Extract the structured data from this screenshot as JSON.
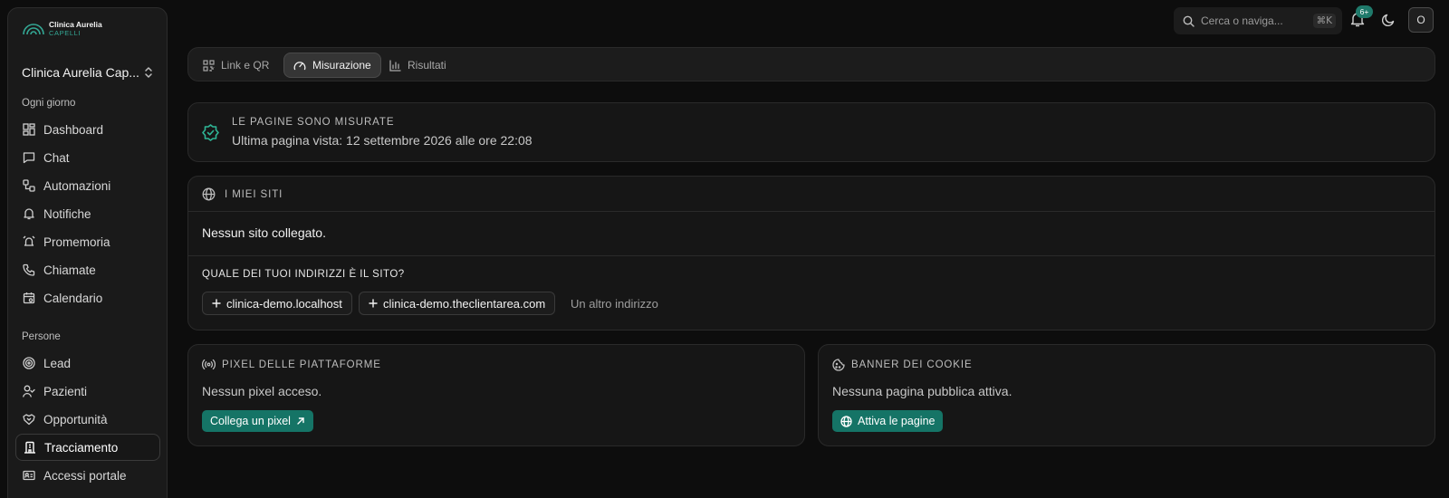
{
  "brand": {
    "name": "Clinica Aurelia",
    "sub": "CAPELLI",
    "accent": "#34a895"
  },
  "org": {
    "name": "Clinica Aurelia Cap..."
  },
  "sidebar": {
    "section_daily": "Ogni giorno",
    "daily_items": [
      {
        "label": "Dashboard",
        "icon": "dashboard-icon"
      },
      {
        "label": "Chat",
        "icon": "chat-icon"
      },
      {
        "label": "Automazioni",
        "icon": "automation-icon"
      },
      {
        "label": "Notifiche",
        "icon": "bell-icon"
      },
      {
        "label": "Promemoria",
        "icon": "alarm-icon"
      },
      {
        "label": "Chiamate",
        "icon": "phone-icon"
      },
      {
        "label": "Calendario",
        "icon": "calendar-icon"
      }
    ],
    "section_people": "Persone",
    "people_items": [
      {
        "label": "Lead",
        "icon": "target-icon"
      },
      {
        "label": "Pazienti",
        "icon": "user-check-icon"
      },
      {
        "label": "Opportunità",
        "icon": "handshake-icon"
      },
      {
        "label": "Tracciamento",
        "icon": "building-icon",
        "active": true
      },
      {
        "label": "Accessi portale",
        "icon": "id-card-icon"
      }
    ]
  },
  "topbar": {
    "search_placeholder": "Cerca o naviga...",
    "search_shortcut": "⌘K",
    "notifications_badge": "6+",
    "avatar_initial": "O"
  },
  "tabs": [
    {
      "label": "Link e QR",
      "icon": "qr-icon"
    },
    {
      "label": "Misurazione",
      "icon": "gauge-icon",
      "active": true
    },
    {
      "label": "Risultati",
      "icon": "bar-chart-icon"
    }
  ],
  "status": {
    "title": "LE PAGINE SONO MISURATE",
    "subtitle": "Ultima pagina vista: 12 settembre 2026 alle ore 22:08",
    "color": "#2fb596"
  },
  "sites": {
    "title": "I MIEI SITI",
    "empty": "Nessun sito collegato.",
    "question": "QUALE DEI TUOI INDIRIZZI È IL SITO?",
    "options": [
      "clinica-demo.localhost",
      "clinica-demo.theclientarea.com"
    ],
    "other": "Un altro indirizzo"
  },
  "pixels": {
    "title": "PIXEL DELLE PIATTAFORME",
    "text": "Nessun pixel acceso.",
    "button": "Collega un pixel"
  },
  "cookies": {
    "title": "BANNER DEI COOKIE",
    "text": "Nessuna pagina pubblica attiva.",
    "button": "Attiva le pagine"
  }
}
